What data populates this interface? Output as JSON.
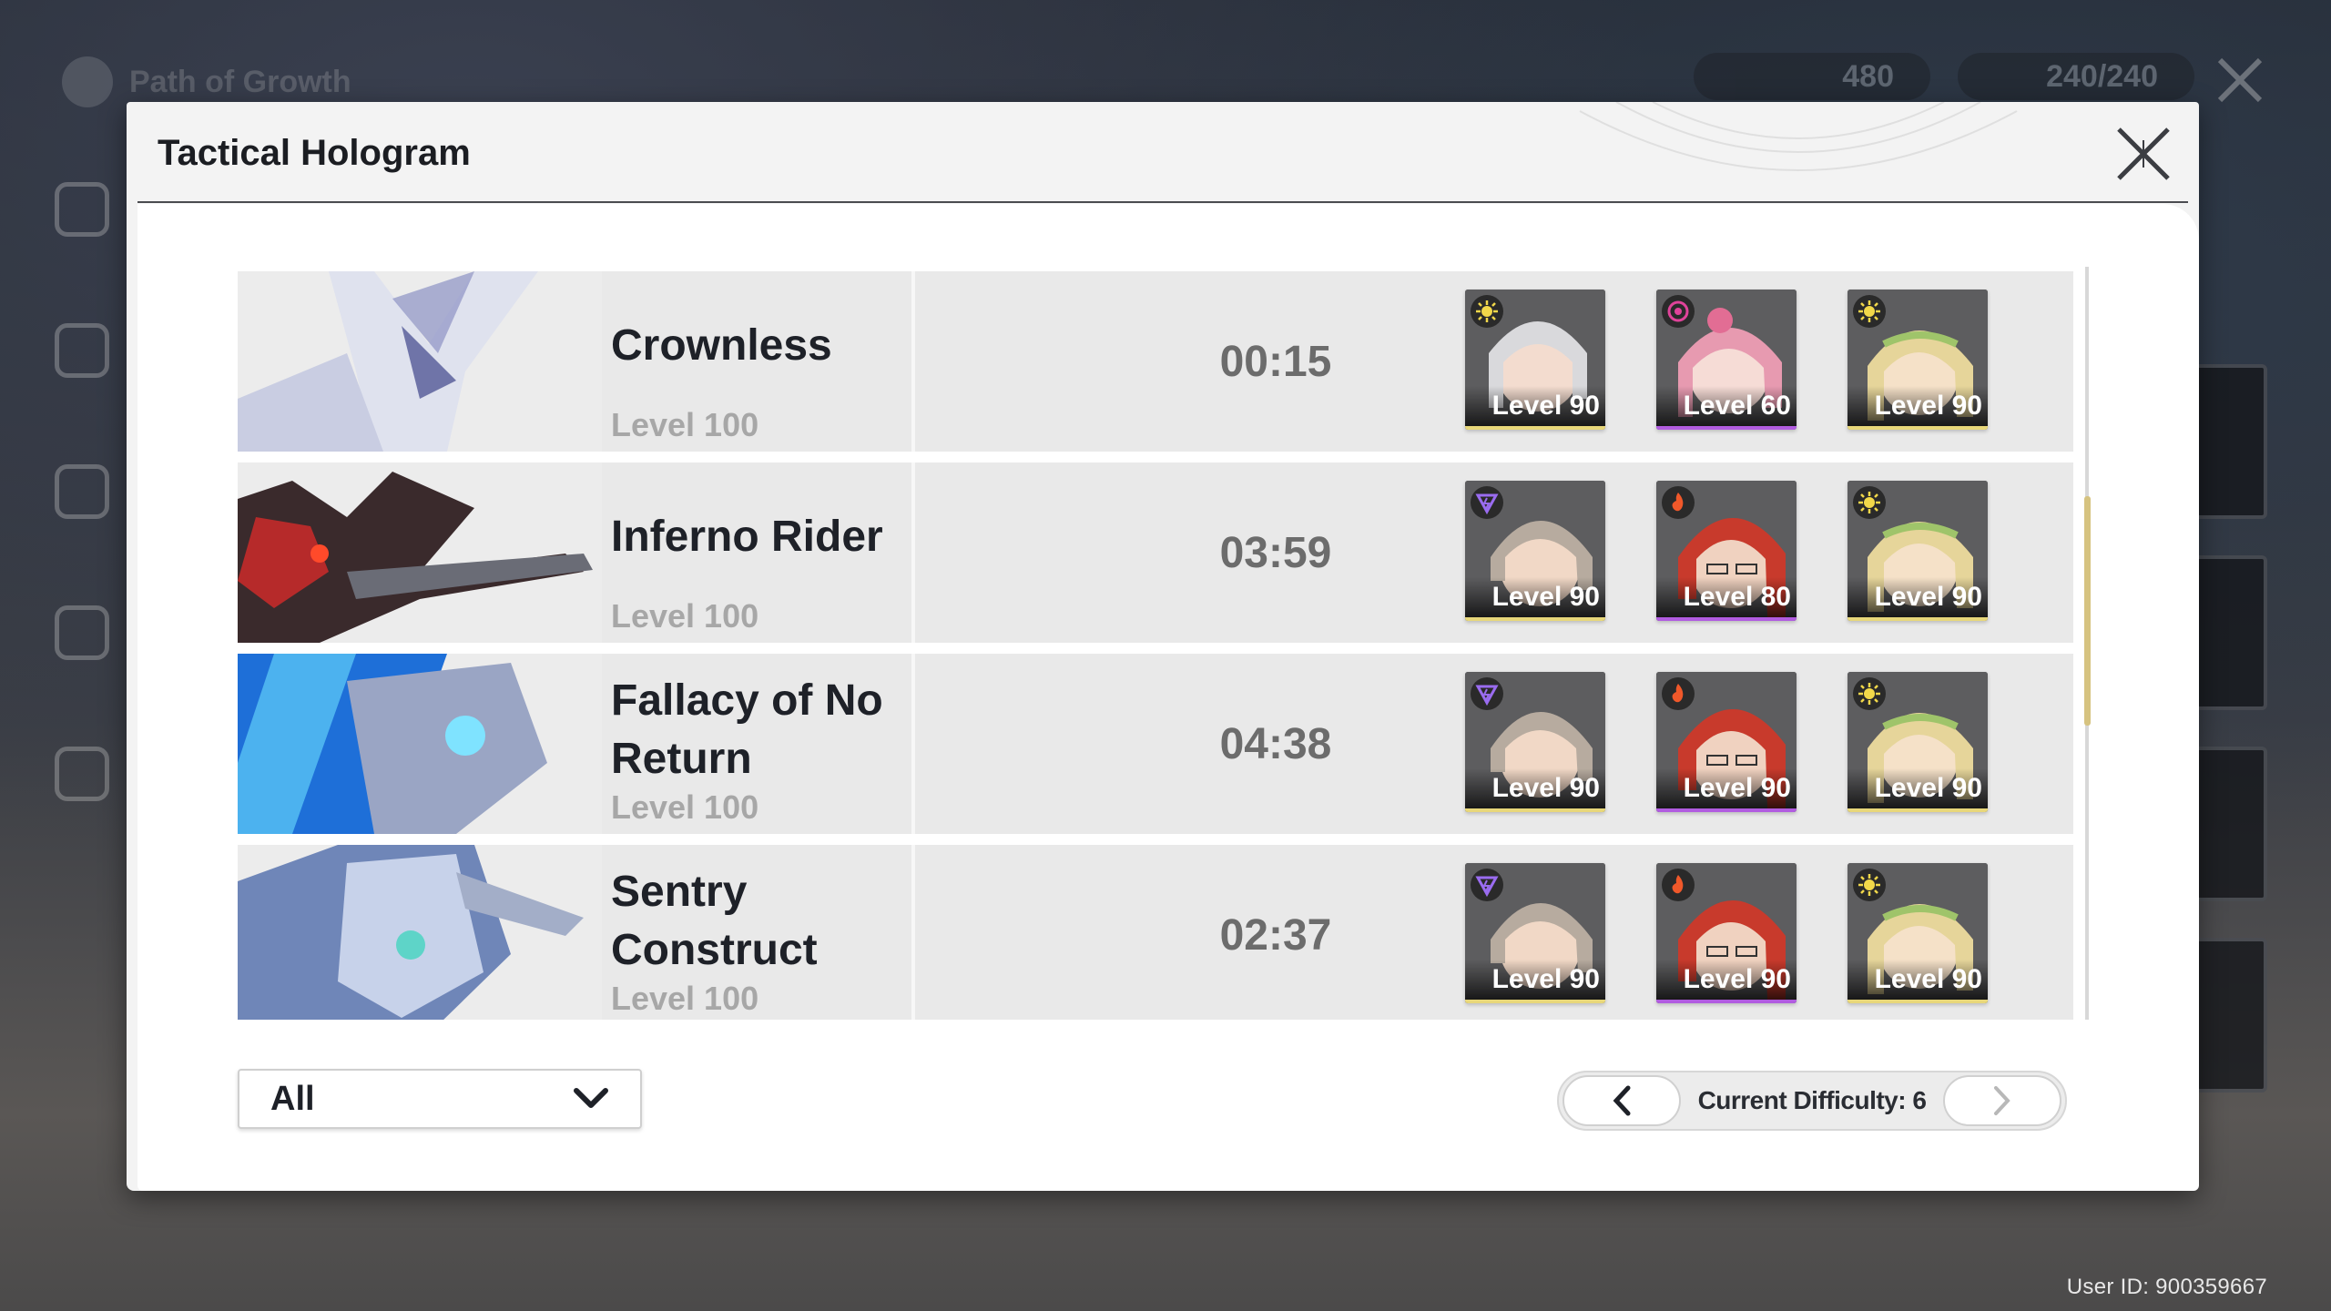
{
  "background": {
    "page_title": "Path of Growth",
    "resource_1": "480",
    "resource_2": "240/240",
    "user_id": "User ID: 900359667"
  },
  "modal": {
    "title": "Tactical Hologram"
  },
  "bosses": [
    {
      "name": "Crownless",
      "level": "Level 100",
      "time": "00:15",
      "team": [
        {
          "level": "Level 90",
          "element": "spectro",
          "rarity": "gold",
          "hair": "#d9d9dc"
        },
        {
          "level": "Level 60",
          "element": "havoc",
          "rarity": "purple",
          "hair": "#e79ab0"
        },
        {
          "level": "Level 90",
          "element": "spectro",
          "rarity": "gold",
          "hair": "#e6d59a"
        }
      ]
    },
    {
      "name": "Inferno Rider",
      "level": "Level 100",
      "time": "03:59",
      "team": [
        {
          "level": "Level 90",
          "element": "electro",
          "rarity": "gold",
          "hair": "#b7ab9f"
        },
        {
          "level": "Level 80",
          "element": "fusion",
          "rarity": "purple",
          "hair": "#c83a2c"
        },
        {
          "level": "Level 90",
          "element": "spectro",
          "rarity": "gold",
          "hair": "#e6d59a"
        }
      ]
    },
    {
      "name": "Fallacy of No Return",
      "level": "Level 100",
      "time": "04:38",
      "team": [
        {
          "level": "Level 90",
          "element": "electro",
          "rarity": "gold",
          "hair": "#b7ab9f"
        },
        {
          "level": "Level 90",
          "element": "fusion",
          "rarity": "purple",
          "hair": "#c83a2c"
        },
        {
          "level": "Level 90",
          "element": "spectro",
          "rarity": "gold",
          "hair": "#e6d59a"
        }
      ]
    },
    {
      "name": "Sentry Construct",
      "level": "Level 100",
      "time": "02:37",
      "team": [
        {
          "level": "Level 90",
          "element": "electro",
          "rarity": "gold",
          "hair": "#b7ab9f"
        },
        {
          "level": "Level 90",
          "element": "fusion",
          "rarity": "purple",
          "hair": "#c83a2c"
        },
        {
          "level": "Level 90",
          "element": "spectro",
          "rarity": "gold",
          "hair": "#e6d59a"
        }
      ]
    }
  ],
  "footer": {
    "filter_value": "All",
    "difficulty_label": "Current Difficulty: 6"
  },
  "colors": {
    "accent_gold": "#d6c380",
    "rarity_gold": "#e8d77a",
    "rarity_purple": "#b15ce0",
    "spectro": "#f2d84a",
    "havoc": "#e0439a",
    "electro": "#9a6cf0",
    "fusion": "#f0582a"
  }
}
